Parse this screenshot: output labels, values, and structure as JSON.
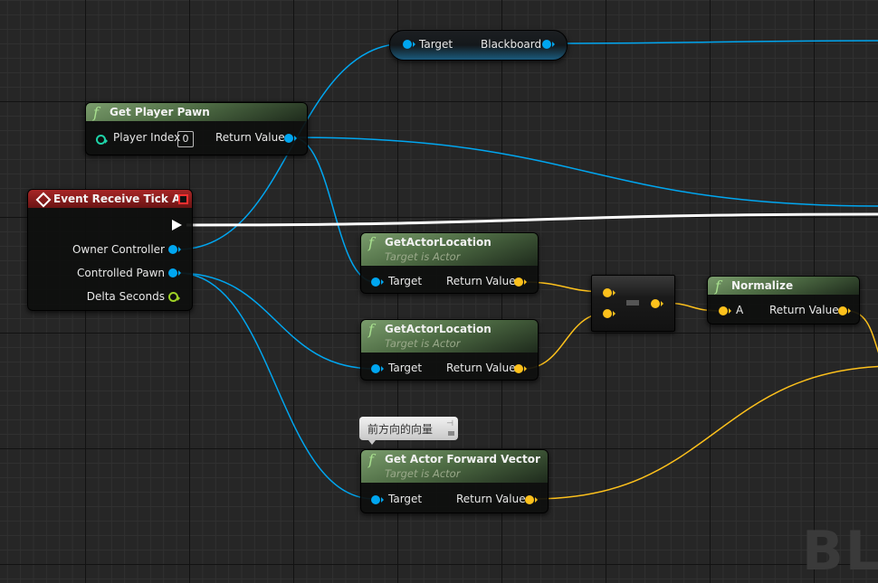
{
  "colors": {
    "object_pin": "#00a6f0",
    "vector_pin": "#fdc11c",
    "float_pin": "#9ed126",
    "int_pin": "#1ed3a8",
    "event_header": "#8a1c1c",
    "function_header": "#5f7f52",
    "exec_wire": "#ffffff"
  },
  "blackboard_node": {
    "target_label": "Target",
    "output_label": "Blackboard"
  },
  "get_player_pawn": {
    "icon": "function-icon",
    "title": "Get Player Pawn",
    "player_index_label": "Player Index",
    "player_index_value": "0",
    "return_label": "Return Value"
  },
  "event_tick": {
    "icon": "event-diamond-icon",
    "title": "Event Receive Tick AI",
    "owner_controller": "Owner Controller",
    "controlled_pawn": "Controlled Pawn",
    "delta_seconds": "Delta Seconds"
  },
  "get_actor_location_1": {
    "title": "GetActorLocation",
    "subtitle": "Target is Actor",
    "target_label": "Target",
    "return_label": "Return Value"
  },
  "get_actor_location_2": {
    "title": "GetActorLocation",
    "subtitle": "Target is Actor",
    "target_label": "Target",
    "return_label": "Return Value"
  },
  "subtract_node": {
    "operator": "-"
  },
  "normalize": {
    "title": "Normalize",
    "a_label": "A",
    "return_label": "Return Value"
  },
  "comment": {
    "text": "前方向的向量"
  },
  "get_forward_vector": {
    "title": "Get Actor Forward Vector",
    "subtitle": "Target is Actor",
    "target_label": "Target",
    "return_label": "Return Value"
  },
  "watermark": "BL"
}
